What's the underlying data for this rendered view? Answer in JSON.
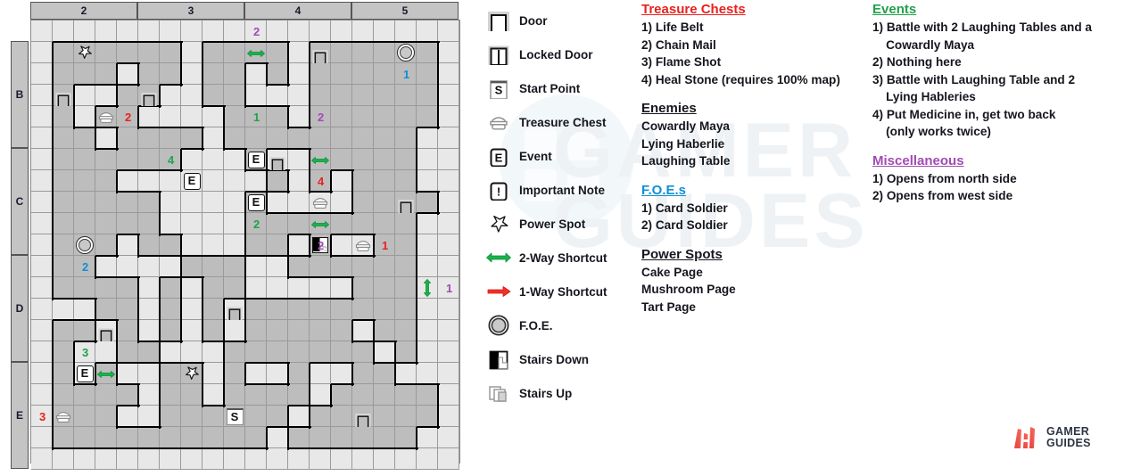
{
  "map": {
    "column_headers": [
      "2",
      "3",
      "4",
      "5"
    ],
    "row_headers": [
      "B",
      "C",
      "D",
      "E"
    ],
    "cols": 20,
    "rows": 21,
    "markers": [
      {
        "name": "power-spot-b2",
        "type": "power-spot",
        "col": 2,
        "row": 1
      },
      {
        "name": "foe-1",
        "type": "foe",
        "col": 17,
        "row": 1
      },
      {
        "name": "door-b1",
        "type": "door",
        "col": 1,
        "row": 3
      },
      {
        "name": "door-b2",
        "type": "door",
        "col": 5,
        "row": 3
      },
      {
        "name": "door-b3",
        "type": "door",
        "col": 13,
        "row": 1
      },
      {
        "name": "chest-2",
        "type": "chest",
        "col": 3,
        "row": 4
      },
      {
        "name": "event-c1",
        "type": "event",
        "col": 10,
        "row": 6
      },
      {
        "name": "door-c1",
        "type": "door",
        "col": 11,
        "row": 6
      },
      {
        "name": "event-c2",
        "type": "event",
        "col": 7,
        "row": 7
      },
      {
        "name": "event-c3",
        "type": "event",
        "col": 10,
        "row": 8
      },
      {
        "name": "chest-4",
        "type": "chest",
        "col": 13,
        "row": 8
      },
      {
        "name": "door-c2",
        "type": "door",
        "col": 17,
        "row": 8
      },
      {
        "name": "foe-2",
        "type": "foe",
        "col": 2,
        "row": 10
      },
      {
        "name": "stairs-down",
        "type": "stairs-down",
        "col": 13,
        "row": 10
      },
      {
        "name": "chest-1",
        "type": "chest",
        "col": 15,
        "row": 10
      },
      {
        "name": "door-d1",
        "type": "door",
        "col": 9,
        "row": 13
      },
      {
        "name": "door-d2",
        "type": "door",
        "col": 3,
        "row": 14
      },
      {
        "name": "event-e1",
        "type": "event",
        "col": 2,
        "row": 16
      },
      {
        "name": "power-spot-e",
        "type": "power-spot",
        "col": 7,
        "row": 16
      },
      {
        "name": "chest-3",
        "type": "chest",
        "col": 1,
        "row": 18
      },
      {
        "name": "start-point",
        "type": "start",
        "col": 9,
        "row": 18
      },
      {
        "name": "door-e1",
        "type": "door",
        "col": 15,
        "row": 18
      }
    ],
    "shortcuts": [
      {
        "name": "shortcut-2way-b",
        "dir": "h",
        "col": 10,
        "row": 1
      },
      {
        "name": "shortcut-2way-c1",
        "dir": "h",
        "col": 13,
        "row": 6
      },
      {
        "name": "shortcut-2way-c2",
        "dir": "h",
        "col": 13,
        "row": 9
      },
      {
        "name": "shortcut-2way-d",
        "dir": "v",
        "col": 18,
        "row": 12
      },
      {
        "name": "shortcut-2way-e",
        "dir": "h",
        "col": 3,
        "row": 16
      }
    ],
    "numbers": [
      {
        "name": "num-misc-2-top",
        "text": "2",
        "color": "purple",
        "col": 10,
        "row": 0
      },
      {
        "name": "num-foe-1",
        "text": "1",
        "color": "blue",
        "col": 17,
        "row": 2
      },
      {
        "name": "num-chest-2",
        "text": "2",
        "color": "red",
        "col": 4,
        "row": 4
      },
      {
        "name": "num-event-1",
        "text": "1",
        "color": "green",
        "col": 10,
        "row": 4
      },
      {
        "name": "num-misc-2-mid",
        "text": "2",
        "color": "purple",
        "col": 13,
        "row": 4
      },
      {
        "name": "num-event-4",
        "text": "4",
        "color": "green",
        "col": 6,
        "row": 6
      },
      {
        "name": "num-chest-4",
        "text": "4",
        "color": "red",
        "col": 13,
        "row": 7
      },
      {
        "name": "num-event-2",
        "text": "2",
        "color": "green",
        "col": 10,
        "row": 9
      },
      {
        "name": "num-misc-2-low",
        "text": "2",
        "color": "purple",
        "col": 13,
        "row": 10
      },
      {
        "name": "num-chest-1",
        "text": "1",
        "color": "red",
        "col": 16,
        "row": 10
      },
      {
        "name": "num-foe-2",
        "text": "2",
        "color": "blue",
        "col": 2,
        "row": 11
      },
      {
        "name": "num-misc-1",
        "text": "1",
        "color": "purple",
        "col": 19,
        "row": 12
      },
      {
        "name": "num-event-3",
        "text": "3",
        "color": "green",
        "col": 2,
        "row": 15
      },
      {
        "name": "num-chest-3",
        "text": "3",
        "color": "red",
        "col": 0,
        "row": 18
      }
    ]
  },
  "legend": {
    "items": [
      {
        "icon": "door-icon",
        "label": "Door"
      },
      {
        "icon": "locked-door-icon",
        "label": "Locked Door"
      },
      {
        "icon": "start-point-icon",
        "label": "Start Point"
      },
      {
        "icon": "treasure-chest-icon",
        "label": "Treasure Chest"
      },
      {
        "icon": "event-icon",
        "label": "Event"
      },
      {
        "icon": "important-note-icon",
        "label": "Important Note"
      },
      {
        "icon": "power-spot-icon",
        "label": "Power Spot"
      },
      {
        "icon": "two-way-shortcut-icon",
        "label": "2-Way Shortcut"
      },
      {
        "icon": "one-way-shortcut-icon",
        "label": "1-Way Shortcut"
      },
      {
        "icon": "foe-icon",
        "label": "F.O.E."
      },
      {
        "icon": "stairs-down-icon",
        "label": "Stairs Down"
      },
      {
        "icon": "stairs-up-icon",
        "label": "Stairs Up"
      }
    ]
  },
  "notes": {
    "treasure_chests": {
      "title": "Treasure Chests",
      "items": [
        "1) Life Belt",
        "2) Chain Mail",
        "3) Flame Shot",
        "4) Heal Stone (requires 100% map)"
      ]
    },
    "enemies": {
      "title": "Enemies",
      "items": [
        "Cowardly Maya",
        "Lying Haberlie",
        "Laughing Table"
      ]
    },
    "foes": {
      "title": "F.O.E.s",
      "items": [
        "1) Card Soldier",
        "2) Card Soldier"
      ]
    },
    "power_spots": {
      "title": "Power Spots",
      "items": [
        "Cake Page",
        "Mushroom Page",
        "Tart Page"
      ]
    },
    "events": {
      "title": "Events",
      "items": [
        "1) Battle with 2 Laughing Tables and a",
        "    Cowardly Maya",
        "2) Nothing here",
        "3) Battle with Laughing Table and 2",
        "    Lying Hableries",
        "4) Put Medicine in, get two back",
        "    (only works twice)"
      ]
    },
    "miscellaneous": {
      "title": "Miscellaneous",
      "items": [
        "1) Opens from north side",
        "2) Opens from west side"
      ]
    }
  },
  "branding": {
    "line1": "GAMER",
    "line2": "GUIDES"
  },
  "watermark": {
    "line1": "GAMER",
    "line2": "GUIDES"
  },
  "colors": {
    "red": "#e8221f",
    "green": "#21a14b",
    "blue": "#0f8fd6",
    "purple": "#a14bb5",
    "floor": "#bdbdbd",
    "empty": "#e8e8e8",
    "wall": "#000000"
  }
}
